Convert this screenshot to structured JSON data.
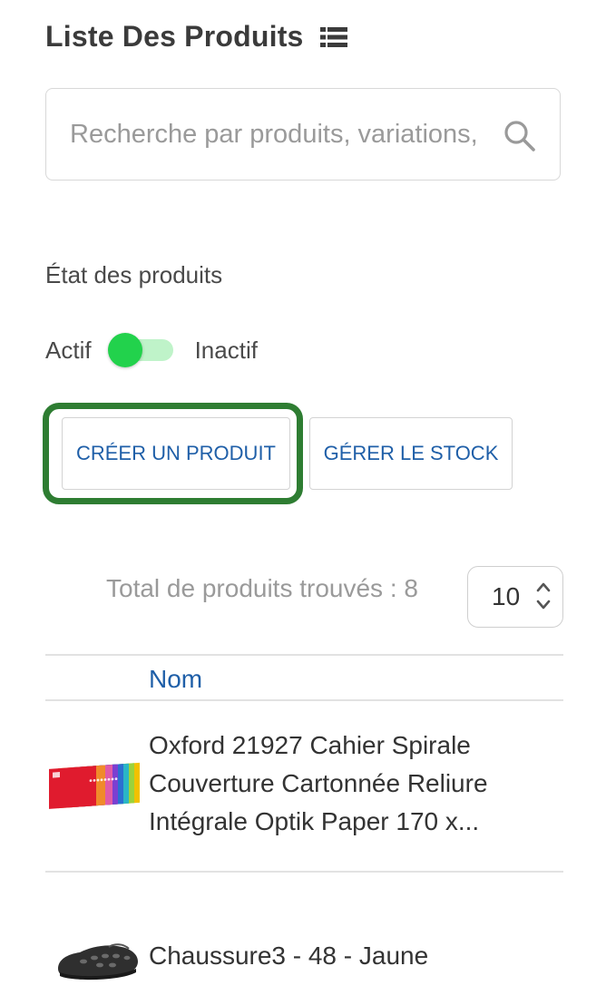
{
  "header": {
    "title": "Liste Des Produits",
    "icon": "list-icon"
  },
  "search": {
    "placeholder": "Recherche par produits, variations, ",
    "value": "",
    "icon": "search-icon"
  },
  "status_filter": {
    "label": "État des produits",
    "active_label": "Actif",
    "inactive_label": "Inactif",
    "toggle_state": "active",
    "toggle_color": "#22d24c"
  },
  "actions": {
    "create_label": "CRÉER UN PRODUIT",
    "stock_label": "GÉRER LE STOCK",
    "highlight_color": "#2e7d32"
  },
  "results": {
    "total_label": "Total de produits trouvés : 8",
    "per_page": "10"
  },
  "table": {
    "columns": [
      "Nom"
    ],
    "rows": [
      {
        "thumbnail": "notebooks-image",
        "name_lines": [
          "Oxford 21927 Cahier Spirale",
          "Couverture Cartonnée Reliure",
          "Intégrale Optik Paper 170 x..."
        ]
      },
      {
        "thumbnail": "shoe-image",
        "name_lines": [
          "Chaussure3 - 48 - Jaune"
        ]
      }
    ]
  }
}
